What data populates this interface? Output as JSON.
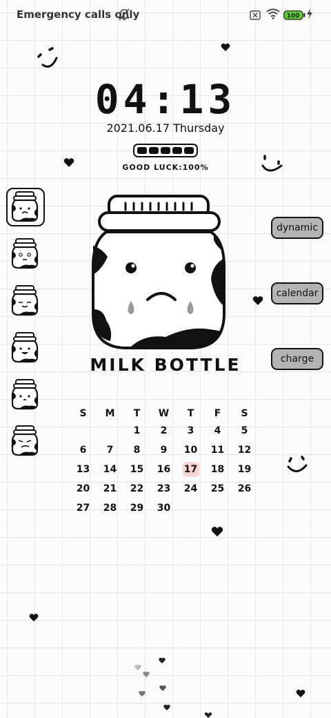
{
  "status_bar": {
    "carrier": "Emergency calls only",
    "battery": "100",
    "icons": [
      "bell-off-icon",
      "sim-disabled-icon",
      "wifi-icon",
      "battery-icon",
      "charging-bolt-icon"
    ]
  },
  "clock": {
    "time": "04:13",
    "date": "2021.06.17 Thursday",
    "luck_label": "GOOD LUCK:100%",
    "luck_level": 1.0
  },
  "widget": {
    "title": "MILK BOTTLE"
  },
  "side_menu": [
    "sad-bottle",
    "dizzy-bottle",
    "sleepy-bottle",
    "happy-bottle",
    "calm-bottle",
    "grumpy-bottle"
  ],
  "buttons": {
    "dynamic": "dynamic",
    "calendar": "calendar",
    "charge": "charge"
  },
  "calendar": {
    "weekdays": [
      "S",
      "M",
      "T",
      "W",
      "T",
      "F",
      "S"
    ],
    "weeks": [
      [
        "",
        "",
        "1",
        "2",
        "3",
        "4",
        "5"
      ],
      [
        "6",
        "7",
        "8",
        "9",
        "10",
        "11",
        "12"
      ],
      [
        "13",
        "14",
        "15",
        "16",
        "17",
        "18",
        "19"
      ],
      [
        "20",
        "21",
        "22",
        "23",
        "24",
        "25",
        "26"
      ],
      [
        "27",
        "28",
        "29",
        "30",
        "",
        "",
        ""
      ]
    ],
    "today": "17"
  },
  "colors": {
    "today_highlight": "#fbd4d4",
    "button_fill": "#b4b4b4",
    "battery_green": "#5bd02c"
  }
}
